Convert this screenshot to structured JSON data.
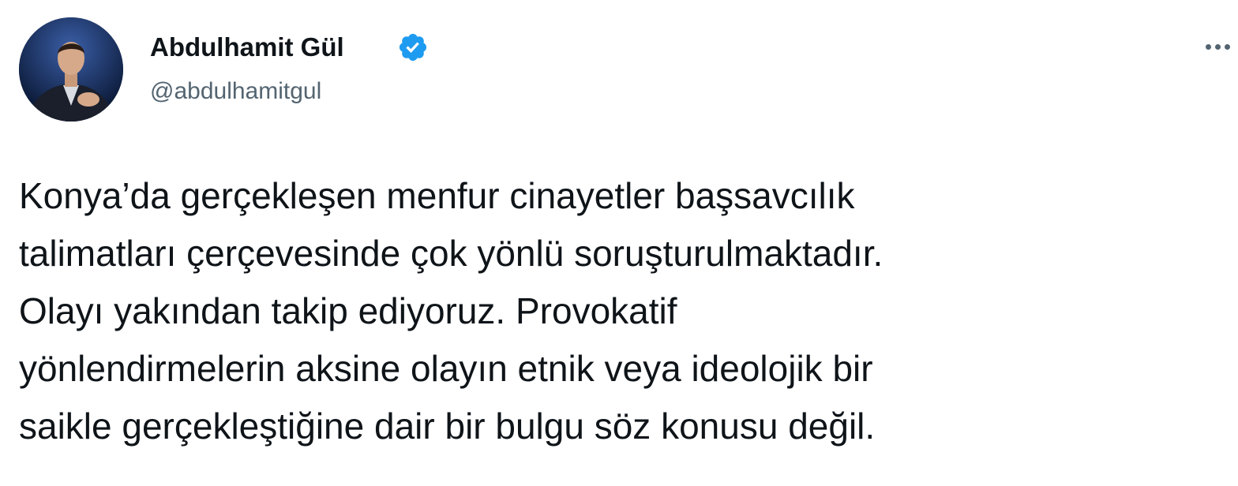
{
  "author": {
    "name": "Abdulhamit Gül",
    "handle": "@abdulhamitgul",
    "verified": true,
    "avatar_icon": "profile-photo",
    "verified_icon": "verified-badge-icon"
  },
  "actions": {
    "more_icon": "more-options-icon"
  },
  "tweet": {
    "lines": [
      "Konya’da gerçekleşen menfur cinayetler başsavcılık",
      "talimatları çerçevesinde çok yönlü soruşturulmaktadır.",
      "Olayı yakından takip ediyoruz. Provokatif",
      "yönlendirmelerin aksine olayın etnik veya ideolojik bir",
      "saikle gerçekleştiğine dair bir bulgu söz konusu değil."
    ]
  },
  "colors": {
    "text": "#0f1419",
    "secondary": "#536471",
    "verified": "#1d9bf0",
    "background": "#ffffff"
  }
}
